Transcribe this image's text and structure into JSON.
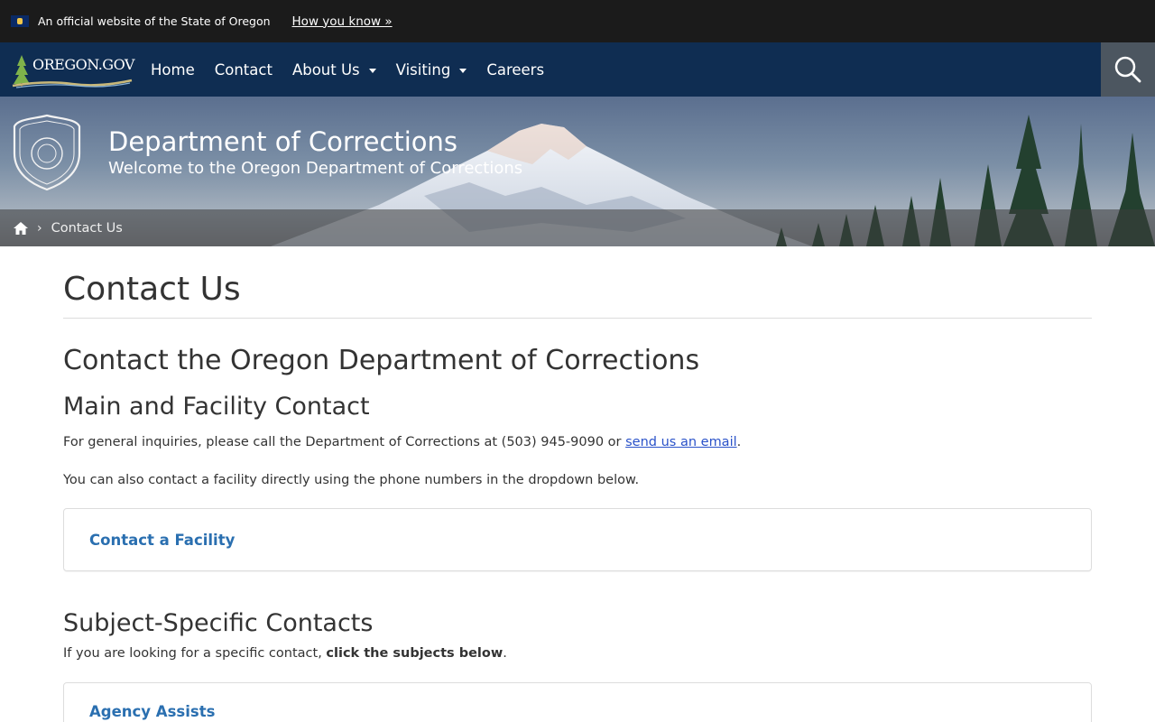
{
  "banner": {
    "official_text": "An official website of the State of Oregon",
    "how_link": "How you know »"
  },
  "nav": {
    "logo_text": "OREGON.GOV",
    "items": [
      {
        "label": "Home"
      },
      {
        "label": "Contact"
      },
      {
        "label": "About Us"
      },
      {
        "label": "Visiting"
      },
      {
        "label": "Careers"
      }
    ]
  },
  "hero": {
    "title": "Department of Corrections",
    "subtitle": "Welcome to the Oregon Department of Corrections"
  },
  "breadcrumb": {
    "current": "Contact Us"
  },
  "main": {
    "page_title": "Contact Us",
    "heading": "Contact the Oregon Department of Corrections",
    "section1_title": "Main and Facility Contact",
    "general_text_before": "For general inquiries, please call the Department of Corrections at (503) 945-9090 or ",
    "email_link": "send us an email",
    "general_text_after": ".",
    "facility_text": "You can also contact a facility directly using the phone numbers in the dropdown below.",
    "facility_panel": "Contact a Facility",
    "section2_title": "Subject-Specific Contacts",
    "subject_text_before": "If you are looking for a specific contact, ",
    "subject_text_bold": "click the subjects below",
    "subject_text_after": ".",
    "subject_panel": "Agency Assists"
  },
  "colors": {
    "banner_bg": "#1b1b1b",
    "nav_bg": "#0f2d52",
    "search_bg": "#4c5660",
    "link": "#2a52c9",
    "panel_link": "#2a6fb0"
  }
}
